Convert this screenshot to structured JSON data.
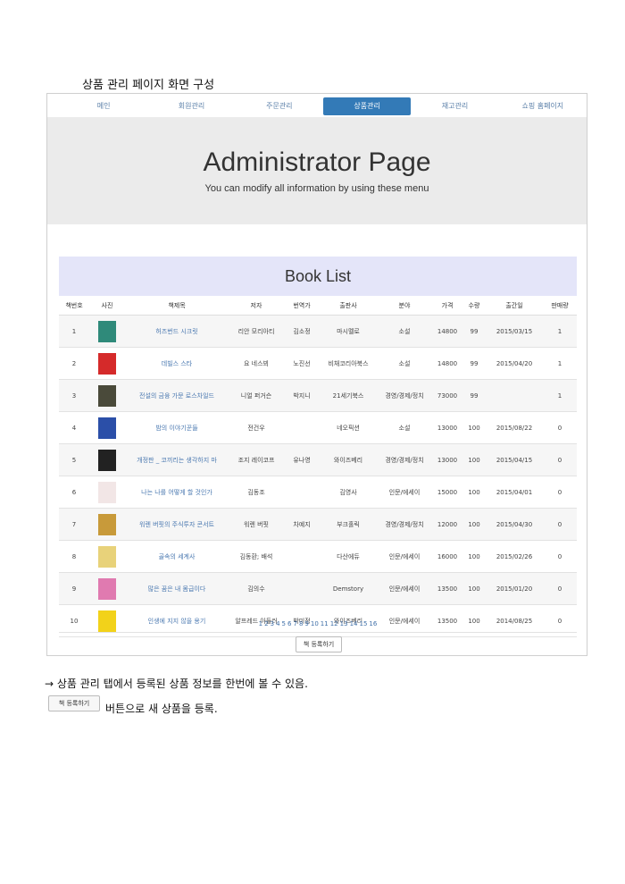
{
  "doc_title": "상품 관리 페이지 화면 구성",
  "nav": {
    "tabs": [
      {
        "label": "메인",
        "active": false
      },
      {
        "label": "회원관리",
        "active": false
      },
      {
        "label": "주문관리",
        "active": false
      },
      {
        "label": "상품관리",
        "active": true
      },
      {
        "label": "재고관리",
        "active": false
      },
      {
        "label": "쇼핑 홈페이지",
        "active": false
      }
    ]
  },
  "hero": {
    "title": "Administrator Page",
    "subtitle": "You can modify all information by using these menu"
  },
  "book_list": {
    "heading": "Book List",
    "columns": [
      "책번호",
      "사진",
      "책제목",
      "저자",
      "번역가",
      "출판사",
      "분야",
      "가격",
      "수량",
      "출간일",
      "판매량"
    ],
    "rows": [
      {
        "no": "1",
        "title": "허즈번드 시크릿",
        "author": "리안 모리아티",
        "translator": "김소정",
        "publisher": "마시멜로",
        "category": "소설",
        "price": "14800",
        "qty": "99",
        "date": "2015/03/15",
        "sales": "1",
        "cover": "#2f8a7a"
      },
      {
        "no": "2",
        "title": "데빌스 스타",
        "author": "요 네스뵈",
        "translator": "노진선",
        "publisher": "비채코리아북스",
        "category": "소설",
        "price": "14800",
        "qty": "99",
        "date": "2015/04/20",
        "sales": "1",
        "cover": "#d52a2a"
      },
      {
        "no": "3",
        "title": "전설의 금융 가문 로스차일드",
        "author": "니얼 퍼거슨",
        "translator": "박지니",
        "publisher": "21세기북스",
        "category": "경영/경제/정치",
        "price": "73000",
        "qty": "99",
        "date": "",
        "sales": "1",
        "cover": "#4a4a3a"
      },
      {
        "no": "4",
        "title": "밤의 이야기꾼들",
        "author": "전건우",
        "translator": "",
        "publisher": "네오픽션",
        "category": "소설",
        "price": "13000",
        "qty": "100",
        "date": "2015/08/22",
        "sales": "0",
        "cover": "#2b4fa8"
      },
      {
        "no": "5",
        "title": "개정판 _ 코끼리는 생각하지 마",
        "author": "조지 레이코프",
        "translator": "유나영",
        "publisher": "와이즈베리",
        "category": "경영/경제/정치",
        "price": "13000",
        "qty": "100",
        "date": "2015/04/15",
        "sales": "0",
        "cover": "#222222"
      },
      {
        "no": "6",
        "title": "나는 나를 어떻게 할 것인가",
        "author": "김동조",
        "translator": "",
        "publisher": "김영사",
        "category": "인문/에세이",
        "price": "15000",
        "qty": "100",
        "date": "2015/04/01",
        "sales": "0",
        "cover": "#f2e6e6"
      },
      {
        "no": "7",
        "title": "워렌 버핏의 주식투자 콘서트",
        "author": "워렌 버핏",
        "translator": "차예지",
        "publisher": "부크홀릭",
        "category": "경영/경제/정치",
        "price": "12000",
        "qty": "100",
        "date": "2015/04/30",
        "sales": "0",
        "cover": "#c89a3a"
      },
      {
        "no": "8",
        "title": "골속의 세계사",
        "author": "김동환; 배석",
        "translator": "",
        "publisher": "다산에듀",
        "category": "인문/에세이",
        "price": "16000",
        "qty": "100",
        "date": "2015/02/26",
        "sales": "0",
        "cover": "#e8d27a"
      },
      {
        "no": "9",
        "title": "많은 꿈은 내 몸급이다",
        "author": "김의수",
        "translator": "",
        "publisher": "Demstory",
        "category": "인문/에세이",
        "price": "13500",
        "qty": "100",
        "date": "2015/01/20",
        "sales": "0",
        "cover": "#e07ab0"
      },
      {
        "no": "10",
        "title": "인생에 지지 않을 용기",
        "author": "알프레드 아들러",
        "translator": "박미정",
        "publisher": "와이즈베리",
        "category": "인문/에세이",
        "price": "13500",
        "qty": "100",
        "date": "2014/08/25",
        "sales": "0",
        "cover": "#f2d21a"
      }
    ],
    "pages": [
      "1",
      "2",
      "3",
      "4",
      "5",
      "6",
      "7",
      "8",
      "9",
      "10",
      "11",
      "12",
      "13",
      "14",
      "15",
      "16"
    ],
    "register_button": "책 등록하기"
  },
  "note1": "→ 상품 관리 탭에서 등록된 상품 정보를 한번에 볼 수 있음.",
  "inline_button": "책 등록하기",
  "note2": "버튼으로 새 상품을 등록."
}
